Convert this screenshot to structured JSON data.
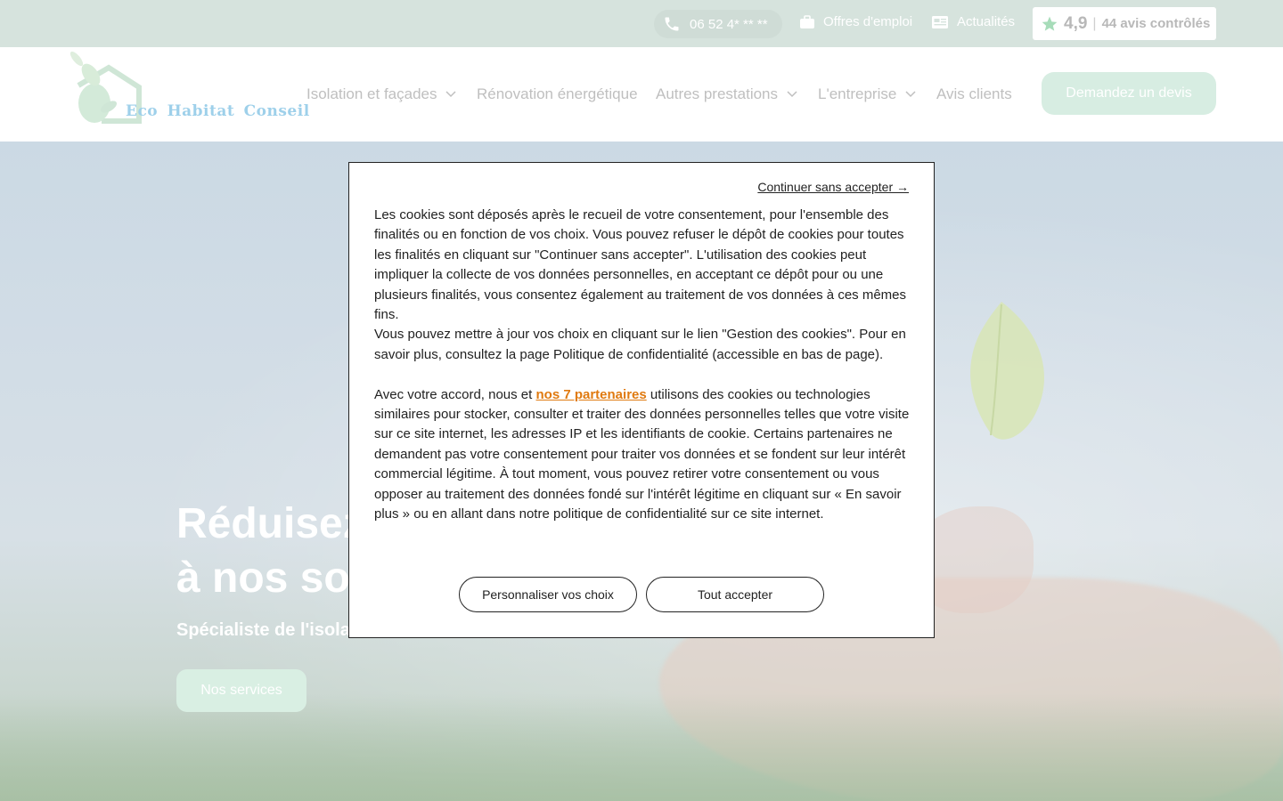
{
  "topbar": {
    "phone": "06 52 4* ** **",
    "jobs_label": "Offres d'emploi",
    "news_label": "Actualités",
    "rating_score": "4,9",
    "rating_separator": "|",
    "rating_count": "44 avis contrôlés"
  },
  "header": {
    "logo_text": "Eco Habitat Conseil",
    "nav": [
      {
        "label": "Isolation et façades",
        "dropdown": true
      },
      {
        "label": "Rénovation énergétique",
        "dropdown": false
      },
      {
        "label": "Autres prestations",
        "dropdown": true
      },
      {
        "label": "L'entreprise",
        "dropdown": true
      },
      {
        "label": "Avis clients",
        "dropdown": false
      }
    ],
    "cta_label": "Demandez un devis"
  },
  "hero": {
    "title_line1": "Réduisez",
    "title_line2": "à nos sol",
    "subtitle": "Spécialiste de l'isola",
    "button_label": "Nos services"
  },
  "cookie_modal": {
    "continue_label": "Continuer sans accepter →",
    "paragraph1": "Les cookies sont déposés après le recueil de votre consentement, pour l'ensemble des finalités ou en fonction de vos choix. Vous pouvez refuser le dépôt de cookies pour toutes les finalités en cliquant sur \"Continuer sans accepter\". L'utilisation des cookies peut impliquer la collecte de vos données personnelles, en acceptant ce dépôt pour ou une plusieurs finalités, vous consentez également au traitement de vos données à ces mêmes fins.",
    "paragraph2": "Vous pouvez mettre à jour vos choix en cliquant sur le lien \"Gestion des cookies\". Pour en savoir plus, consultez la page Politique de confidentialité (accessible en bas de page).",
    "paragraph3_before": "Avec votre accord, nous et ",
    "partners_link": "nos 7 partenaires",
    "paragraph3_after": " utilisons des cookies ou technologies similaires pour stocker, consulter et traiter des données personnelles telles que votre visite sur ce site internet, les adresses IP et les identifiants de cookie. Certains partenaires ne demandent pas votre consentement pour traiter vos données et se fondent sur leur intérêt commercial légitime. À tout moment, vous pouvez retirer votre consentement ou vous opposer au traitement des données fondé sur l'intérêt légitime en cliquant sur « En savoir plus » ou en allant dans notre politique de confidentialité sur ce site internet.",
    "customize_label": "Personnaliser vos choix",
    "accept_label": "Tout accepter"
  },
  "colors": {
    "topbar_bg": "#d6e3dd",
    "cta_bg": "#d7ede2",
    "link_orange": "#e07a10",
    "logo_blue": "#9ed0ea"
  }
}
